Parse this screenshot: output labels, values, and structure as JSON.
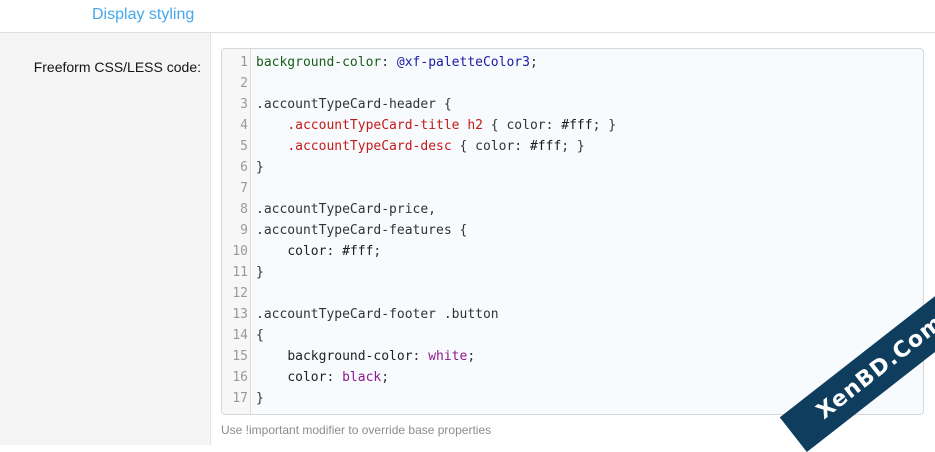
{
  "section": {
    "title": "Display styling"
  },
  "field": {
    "label": "Freeform CSS/LESS code:",
    "hint": "Use !important modifier to override base properties"
  },
  "editor": {
    "lines": [
      {
        "n": "1",
        "tokens": [
          {
            "t": "background-color",
            "c": "tok-prop"
          },
          {
            "t": ": ",
            "c": "tok-punct"
          },
          {
            "t": "@xf-paletteColor3",
            "c": "tok-var"
          },
          {
            "t": ";",
            "c": "tok-punct"
          }
        ]
      },
      {
        "n": "2",
        "tokens": []
      },
      {
        "n": "3",
        "tokens": [
          {
            "t": ".accountTypeCard-header",
            "c": "tok-sel"
          },
          {
            "t": " {",
            "c": "tok-punct"
          }
        ]
      },
      {
        "n": "4",
        "tokens": [
          {
            "t": "    ",
            "c": "tok-punct"
          },
          {
            "t": ".accountTypeCard-title",
            "c": "tok-cls"
          },
          {
            "t": " ",
            "c": "tok-punct"
          },
          {
            "t": "h2",
            "c": "tok-tag"
          },
          {
            "t": " { color: ",
            "c": "tok-punct"
          },
          {
            "t": "#fff",
            "c": "tok-val"
          },
          {
            "t": "; }",
            "c": "tok-punct"
          }
        ]
      },
      {
        "n": "5",
        "tokens": [
          {
            "t": "    ",
            "c": "tok-punct"
          },
          {
            "t": ".accountTypeCard-desc",
            "c": "tok-cls"
          },
          {
            "t": " { color: ",
            "c": "tok-punct"
          },
          {
            "t": "#fff",
            "c": "tok-val"
          },
          {
            "t": "; }",
            "c": "tok-punct"
          }
        ]
      },
      {
        "n": "6",
        "tokens": [
          {
            "t": "}",
            "c": "tok-punct"
          }
        ]
      },
      {
        "n": "7",
        "tokens": []
      },
      {
        "n": "8",
        "tokens": [
          {
            "t": ".accountTypeCard-price,",
            "c": "tok-sel"
          }
        ]
      },
      {
        "n": "9",
        "tokens": [
          {
            "t": ".accountTypeCard-features",
            "c": "tok-sel"
          },
          {
            "t": " {",
            "c": "tok-punct"
          }
        ]
      },
      {
        "n": "10",
        "tokens": [
          {
            "t": "    ",
            "c": "tok-punct"
          },
          {
            "t": "color",
            "c": "tok-prop2"
          },
          {
            "t": ": ",
            "c": "tok-punct"
          },
          {
            "t": "#fff",
            "c": "tok-val"
          },
          {
            "t": ";",
            "c": "tok-punct"
          }
        ]
      },
      {
        "n": "11",
        "tokens": [
          {
            "t": "}",
            "c": "tok-punct"
          }
        ]
      },
      {
        "n": "12",
        "tokens": []
      },
      {
        "n": "13",
        "tokens": [
          {
            "t": ".accountTypeCard-footer .button",
            "c": "tok-sel"
          }
        ]
      },
      {
        "n": "14",
        "tokens": [
          {
            "t": "{",
            "c": "tok-punct"
          }
        ]
      },
      {
        "n": "15",
        "tokens": [
          {
            "t": "    ",
            "c": "tok-punct"
          },
          {
            "t": "background-color",
            "c": "tok-prop2"
          },
          {
            "t": ": ",
            "c": "tok-punct"
          },
          {
            "t": "white",
            "c": "tok-kw"
          },
          {
            "t": ";",
            "c": "tok-punct"
          }
        ]
      },
      {
        "n": "16",
        "tokens": [
          {
            "t": "    ",
            "c": "tok-punct"
          },
          {
            "t": "color",
            "c": "tok-prop2"
          },
          {
            "t": ": ",
            "c": "tok-punct"
          },
          {
            "t": "black",
            "c": "tok-kw"
          },
          {
            "t": ";",
            "c": "tok-punct"
          }
        ]
      },
      {
        "n": "17",
        "tokens": [
          {
            "t": "}",
            "c": "tok-punct"
          }
        ]
      }
    ]
  },
  "watermark": {
    "text": "XenBD.Com"
  },
  "colors": {
    "accent": "#47a7eb",
    "label_bg": "#f5f5f5",
    "editor_bg": "#f8fbfd",
    "watermark_bg": "#0e3d5e"
  }
}
